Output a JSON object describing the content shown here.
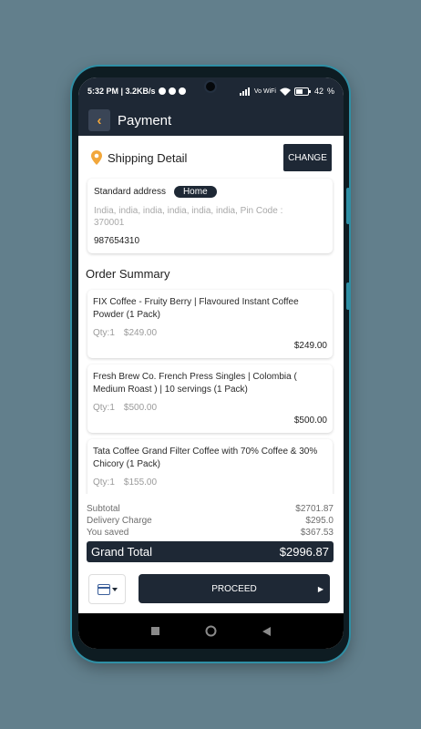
{
  "status_bar": {
    "time_speed": "5:32 PM | 3.2KB/s",
    "network": "Vo WiFi",
    "battery": "42"
  },
  "app_bar": {
    "title": "Payment"
  },
  "shipping": {
    "title": "Shipping Detail",
    "change_label": "CHANGE",
    "address_label": "Standard address",
    "address_type": "Home",
    "address": "India, india, india, india, india, india, Pin Code : 370001",
    "phone": "987654310"
  },
  "order_summary": {
    "title": "Order Summary",
    "items": [
      {
        "name": "FIX Coffee - Fruity Berry | Flavoured Instant Coffee Powder (1 Pack)",
        "qty": "Qty:1",
        "price": "$249.00",
        "total": "$249.00"
      },
      {
        "name": "Fresh Brew Co. French Press Singles | Colombia ( Medium Roast ) | 10 servings (1 Pack)",
        "qty": "Qty:1",
        "price": "$500.00",
        "total": "$500.00"
      },
      {
        "name": "Tata Coffee Grand Filter Coffee with 70% Coffee & 30% Chicory (1 Pack)",
        "qty": "Qty:1",
        "price": "$155.00",
        "total": ""
      }
    ]
  },
  "totals": {
    "subtotal_label": "Subtotal",
    "subtotal": "$2701.87",
    "delivery_label": "Delivery Charge",
    "delivery": "$295.0",
    "saved_label": "You saved",
    "saved": "$367.53",
    "grand_label": "Grand Total",
    "grand": "$2996.87"
  },
  "actions": {
    "proceed_label": "PROCEED"
  },
  "colors": {
    "primary": "#1e2835",
    "accent": "#f2a73b",
    "background": "#627f8c"
  }
}
